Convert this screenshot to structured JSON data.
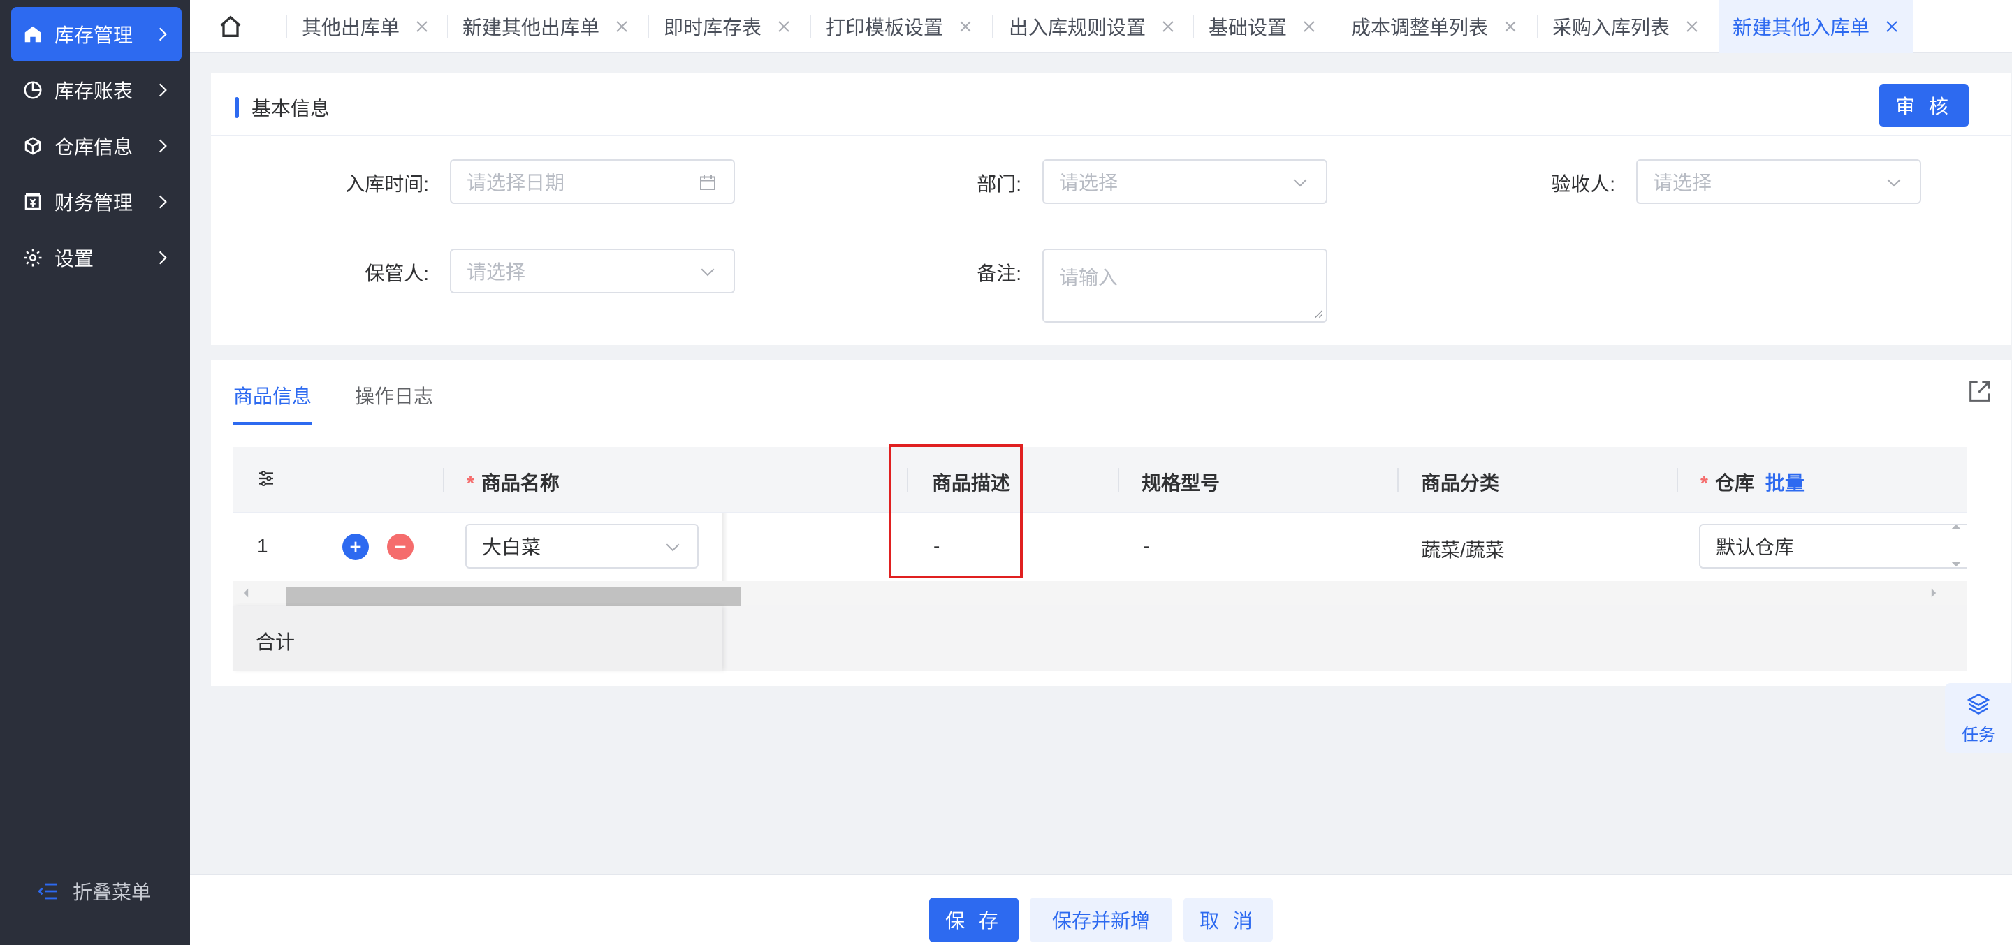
{
  "colors": {
    "accent": "#2d6af0",
    "sidebar_bg": "#2b2f3a",
    "required": "#f56c6c",
    "highlight": "#e02020"
  },
  "sidebar": {
    "items": [
      {
        "label": "库存管理",
        "icon": "home-icon",
        "active": true
      },
      {
        "label": "库存账表",
        "icon": "pie-chart-icon"
      },
      {
        "label": "仓库信息",
        "icon": "cube-icon"
      },
      {
        "label": "财务管理",
        "icon": "finance-icon"
      },
      {
        "label": "设置",
        "icon": "gear-icon"
      }
    ],
    "collapse_label": "折叠菜单"
  },
  "tabs": [
    {
      "label": "其他出库单"
    },
    {
      "label": "新建其他出库单"
    },
    {
      "label": "即时库存表"
    },
    {
      "label": "打印模板设置"
    },
    {
      "label": "出入库规则设置"
    },
    {
      "label": "基础设置"
    },
    {
      "label": "成本调整单列表"
    },
    {
      "label": "采购入库列表"
    },
    {
      "label": "新建其他入库单",
      "active": true
    }
  ],
  "basic_info": {
    "title": "基本信息",
    "audit_button": "审 核",
    "fields": {
      "in_time": {
        "label": "入库时间:",
        "placeholder": "请选择日期"
      },
      "department": {
        "label": "部门:",
        "placeholder": "请选择"
      },
      "inspector": {
        "label": "验收人:",
        "placeholder": "请选择"
      },
      "keeper": {
        "label": "保管人:",
        "placeholder": "请选择"
      },
      "remark": {
        "label": "备注:",
        "placeholder": "请输入"
      }
    }
  },
  "detail_tabs": [
    {
      "label": "商品信息",
      "active": true
    },
    {
      "label": "操作日志"
    }
  ],
  "table": {
    "columns": {
      "name": "商品名称",
      "desc": "商品描述",
      "spec": "规格型号",
      "category": "商品分类",
      "warehouse": "仓库",
      "batch": "批量"
    },
    "rows": [
      {
        "index": "1",
        "name": "大白菜",
        "desc": "-",
        "spec": "-",
        "category": "蔬菜/蔬菜",
        "warehouse": "默认仓库"
      }
    ],
    "total_label": "合计"
  },
  "task_float": "任务",
  "footer": {
    "save": "保 存",
    "save_new": "保存并新增",
    "cancel": "取 消"
  }
}
